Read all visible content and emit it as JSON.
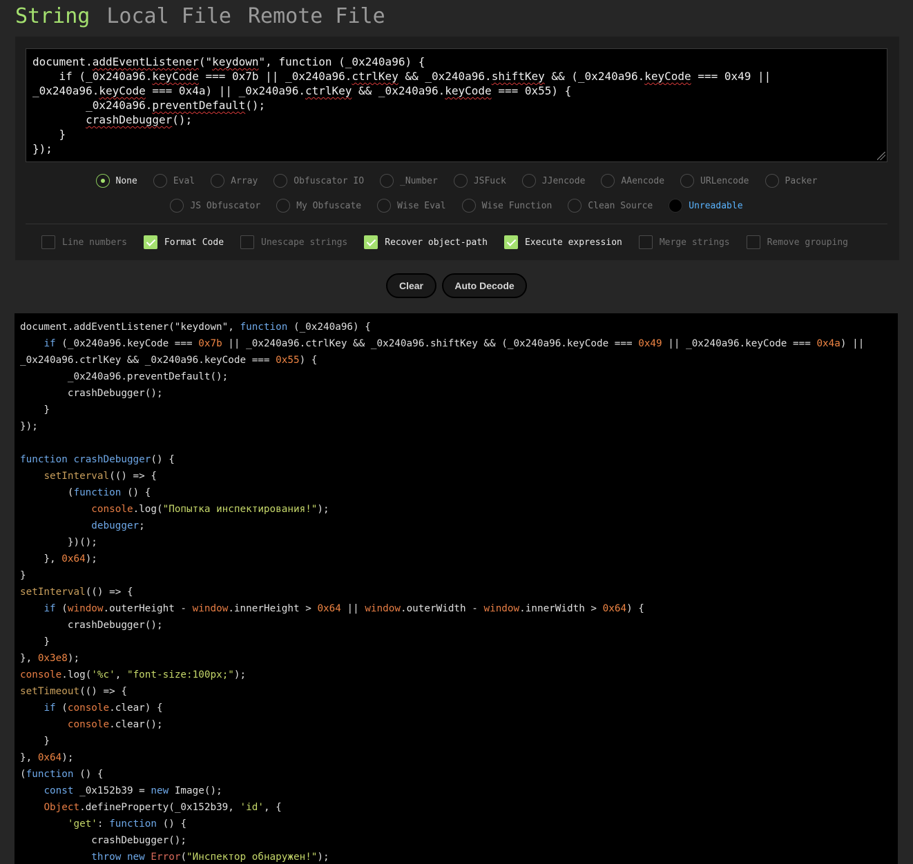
{
  "tabs": [
    {
      "label": "String",
      "active": true
    },
    {
      "label": "Local File",
      "active": false
    },
    {
      "label": "Remote File",
      "active": false
    }
  ],
  "editor": {
    "lines": [
      [
        {
          "t": "document."
        },
        {
          "t": "addEventListener",
          "sq": true
        },
        {
          "t": "(\""
        },
        {
          "t": "keydown",
          "sq": true
        },
        {
          "t": "\", function (_0x240a96) {"
        }
      ],
      [
        {
          "t": "    if (_0x240a96."
        },
        {
          "t": "keyCode",
          "sq": true
        },
        {
          "t": " === 0x7b || _0x240a96."
        },
        {
          "t": "ctrlKey",
          "sq": true
        },
        {
          "t": " && _0x240a96."
        },
        {
          "t": "shiftKey",
          "sq": true
        },
        {
          "t": " && (_0x240a96."
        },
        {
          "t": "keyCode",
          "sq": true
        },
        {
          "t": " === 0x49 ||"
        }
      ],
      [
        {
          "t": "_0x240a96."
        },
        {
          "t": "keyCode",
          "sq": true
        },
        {
          "t": " === 0x4a) || _0x240a96."
        },
        {
          "t": "ctrlKey",
          "sq": true
        },
        {
          "t": " && _0x240a96."
        },
        {
          "t": "keyCode",
          "sq": true
        },
        {
          "t": " === 0x55) {"
        }
      ],
      [
        {
          "t": "        _0x240a96."
        },
        {
          "t": "preventDefault",
          "sq": true
        },
        {
          "t": "();"
        }
      ],
      [
        {
          "t": "        "
        },
        {
          "t": "crashDebugger",
          "sq": true
        },
        {
          "t": "();"
        }
      ],
      [
        {
          "t": "    }"
        }
      ],
      [
        {
          "t": "});"
        }
      ]
    ]
  },
  "encodings": {
    "row1": [
      {
        "label": "None",
        "selected": true
      },
      {
        "label": "Eval"
      },
      {
        "label": "Array"
      },
      {
        "label": "Obfuscator IO"
      },
      {
        "label": "_Number"
      },
      {
        "label": "JSFuck"
      },
      {
        "label": "JJencode"
      },
      {
        "label": "AAencode"
      },
      {
        "label": "URLencode"
      },
      {
        "label": "Packer"
      }
    ],
    "row2": [
      {
        "label": "JS Obfuscator"
      },
      {
        "label": "My Obfuscate"
      },
      {
        "label": "Wise Eval"
      },
      {
        "label": "Wise Function"
      },
      {
        "label": "Clean Source"
      },
      {
        "label": "Unreadable",
        "dark": true
      }
    ]
  },
  "options": [
    {
      "label": "Line numbers",
      "checked": false
    },
    {
      "label": "Format Code",
      "checked": true
    },
    {
      "label": "Unescape strings",
      "checked": false
    },
    {
      "label": "Recover object-path",
      "checked": true
    },
    {
      "label": "Execute expression",
      "checked": true
    },
    {
      "label": "Merge strings",
      "checked": false
    },
    {
      "label": "Remove grouping",
      "checked": false
    }
  ],
  "buttons": {
    "clear": "Clear",
    "auto_decode": "Auto Decode"
  },
  "output": {
    "lines": [
      [
        [
          "",
          "document.addEventListener(\"keydown\", "
        ],
        [
          "kw",
          "function"
        ],
        [
          "",
          " (_0x240a96) {"
        ]
      ],
      [
        [
          "",
          "    "
        ],
        [
          "kw",
          "if"
        ],
        [
          "",
          " (_0x240a96.keyCode === "
        ],
        [
          "num",
          "0x7b"
        ],
        [
          "",
          " || _0x240a96.ctrlKey && _0x240a96.shiftKey && (_0x240a96.keyCode === "
        ],
        [
          "num",
          "0x49"
        ],
        [
          "",
          " || _0x240a96.keyCode === "
        ],
        [
          "num",
          "0x4a"
        ],
        [
          "",
          ") ||"
        ]
      ],
      [
        [
          "",
          "_0x240a96.ctrlKey && _0x240a96.keyCode === "
        ],
        [
          "num",
          "0x55"
        ],
        [
          "",
          ") {"
        ]
      ],
      [
        [
          "",
          "        _0x240a96.preventDefault();"
        ]
      ],
      [
        [
          "",
          "        crashDebugger();"
        ]
      ],
      [
        [
          "",
          "    }"
        ]
      ],
      [
        [
          "",
          "});"
        ]
      ],
      [
        [
          "",
          ""
        ]
      ],
      [
        [
          "kw",
          "function"
        ],
        [
          "",
          " "
        ],
        [
          "kw",
          "crashDebugger"
        ],
        [
          "",
          "() {"
        ]
      ],
      [
        [
          "",
          "    "
        ],
        [
          "fn",
          "setInterval"
        ],
        [
          "",
          "(() => {"
        ]
      ],
      [
        [
          "",
          "        ("
        ],
        [
          "kw",
          "function"
        ],
        [
          "",
          " () {"
        ]
      ],
      [
        [
          "",
          "            "
        ],
        [
          "gl",
          "console"
        ],
        [
          "",
          ".log("
        ],
        [
          "str",
          "\"Попытка инспектирования!\""
        ],
        [
          "",
          ");"
        ]
      ],
      [
        [
          "",
          "            "
        ],
        [
          "kw",
          "debugger"
        ],
        [
          "",
          ";"
        ]
      ],
      [
        [
          "",
          "        })();"
        ]
      ],
      [
        [
          "",
          "    }, "
        ],
        [
          "num",
          "0x64"
        ],
        [
          "",
          ");"
        ]
      ],
      [
        [
          "",
          "}"
        ]
      ],
      [
        [
          "fn",
          "setInterval"
        ],
        [
          "",
          "(() => {"
        ]
      ],
      [
        [
          "",
          "    "
        ],
        [
          "kw",
          "if"
        ],
        [
          "",
          " ("
        ],
        [
          "gl",
          "window"
        ],
        [
          "",
          ".outerHeight - "
        ],
        [
          "gl",
          "window"
        ],
        [
          "",
          ".innerHeight > "
        ],
        [
          "num",
          "0x64"
        ],
        [
          "",
          " || "
        ],
        [
          "gl",
          "window"
        ],
        [
          "",
          ".outerWidth - "
        ],
        [
          "gl",
          "window"
        ],
        [
          "",
          ".innerWidth > "
        ],
        [
          "num",
          "0x64"
        ],
        [
          "",
          ") {"
        ]
      ],
      [
        [
          "",
          "        crashDebugger();"
        ]
      ],
      [
        [
          "",
          "    }"
        ]
      ],
      [
        [
          "",
          "}, "
        ],
        [
          "num",
          "0x3e8"
        ],
        [
          "",
          ");"
        ]
      ],
      [
        [
          "gl",
          "console"
        ],
        [
          "",
          ".log("
        ],
        [
          "str",
          "'%c'"
        ],
        [
          "",
          ", "
        ],
        [
          "str",
          "\"font-size:100px;\""
        ],
        [
          "",
          ");"
        ]
      ],
      [
        [
          "fn",
          "setTimeout"
        ],
        [
          "",
          "(() => {"
        ]
      ],
      [
        [
          "",
          "    "
        ],
        [
          "kw",
          "if"
        ],
        [
          "",
          " ("
        ],
        [
          "gl",
          "console"
        ],
        [
          "",
          ".clear) {"
        ]
      ],
      [
        [
          "",
          "        "
        ],
        [
          "gl",
          "console"
        ],
        [
          "",
          ".clear();"
        ]
      ],
      [
        [
          "",
          "    }"
        ]
      ],
      [
        [
          "",
          "}, "
        ],
        [
          "num",
          "0x64"
        ],
        [
          "",
          ");"
        ]
      ],
      [
        [
          "",
          "("
        ],
        [
          "kw",
          "function"
        ],
        [
          "",
          " () {"
        ]
      ],
      [
        [
          "",
          "    "
        ],
        [
          "kw",
          "const"
        ],
        [
          "",
          " _0x152b39 = "
        ],
        [
          "kw",
          "new"
        ],
        [
          "",
          " Image();"
        ]
      ],
      [
        [
          "",
          "    "
        ],
        [
          "gl",
          "Object"
        ],
        [
          "",
          ".defineProperty(_0x152b39, "
        ],
        [
          "str",
          "'id'"
        ],
        [
          "",
          ", {"
        ]
      ],
      [
        [
          "",
          "        "
        ],
        [
          "str",
          "'get'"
        ],
        [
          "",
          ": "
        ],
        [
          "kw",
          "function"
        ],
        [
          "",
          " () {"
        ]
      ],
      [
        [
          "",
          "            crashDebugger();"
        ]
      ],
      [
        [
          "",
          "            "
        ],
        [
          "kw",
          "throw"
        ],
        [
          "",
          " "
        ],
        [
          "kw",
          "new"
        ],
        [
          "",
          " "
        ],
        [
          "rd",
          "Error"
        ],
        [
          "",
          "("
        ],
        [
          "str",
          "\"Инспектор обнаружен!\""
        ],
        [
          "",
          ");"
        ]
      ]
    ]
  },
  "colors": {
    "accent_green": "#a4e06f",
    "keyword": "#6ea8e8",
    "function_call": "#c99f5c",
    "string": "#c6d86a",
    "number": "#ef8544",
    "global": "#e87e45"
  }
}
